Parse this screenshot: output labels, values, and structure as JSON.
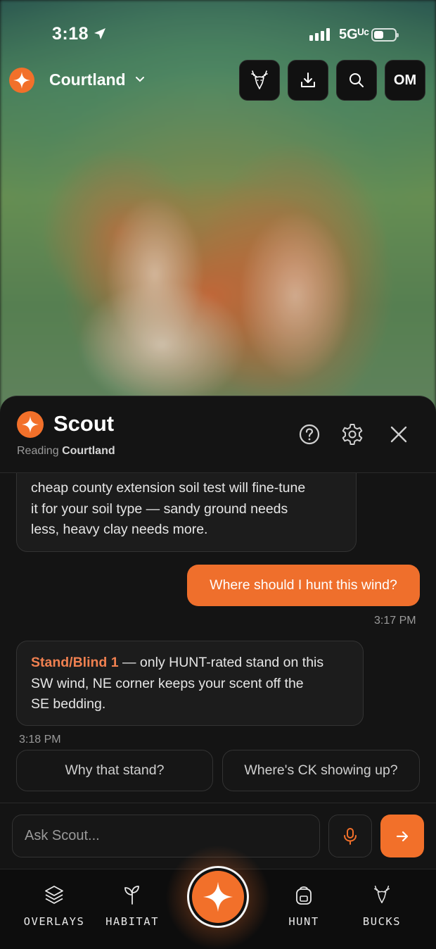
{
  "status_bar": {
    "time": "3:18",
    "network": "5Gᵁᶜ"
  },
  "header": {
    "property_name": "Courtland",
    "om_label": "OM"
  },
  "scout": {
    "title": "Scout",
    "reading_prefix": "Reading",
    "reading_property": "Courtland"
  },
  "chat": {
    "msg1_lines": [
      "cheap county extension soil test will fine-tune",
      "it for your soil type — sandy ground needs",
      "less, heavy clay needs more."
    ],
    "user_msg": "Where should I hunt this wind?",
    "user_time": "3:17 PM",
    "reply_highlight": "Stand/Blind 1",
    "reply_line1_rest": " — only HUNT-rated stand on this",
    "reply_line2": "SW wind, NE corner keeps your scent off the",
    "reply_line3": "SE bedding.",
    "reply_time": "3:18 PM"
  },
  "suggestions": [
    "Why that stand?",
    "Where's CK showing up?"
  ],
  "input": {
    "placeholder": "Ask Scout..."
  },
  "nav": {
    "overlays": "OVERLAYS",
    "habitat": "HABITAT",
    "hunt": "HUNT",
    "bucks": "BUCKS"
  },
  "colors": {
    "accent": "#f2702a",
    "panel": "#141414",
    "bubble": "#1c1c1c"
  },
  "icons": [
    "location-arrow-icon",
    "chevron-down-icon",
    "deer-icon",
    "download-icon",
    "search-icon",
    "help-icon",
    "gear-icon",
    "close-icon",
    "mic-icon",
    "arrow-right-icon",
    "layers-icon",
    "sprout-icon",
    "backpack-icon",
    "sparkle-icon"
  ]
}
